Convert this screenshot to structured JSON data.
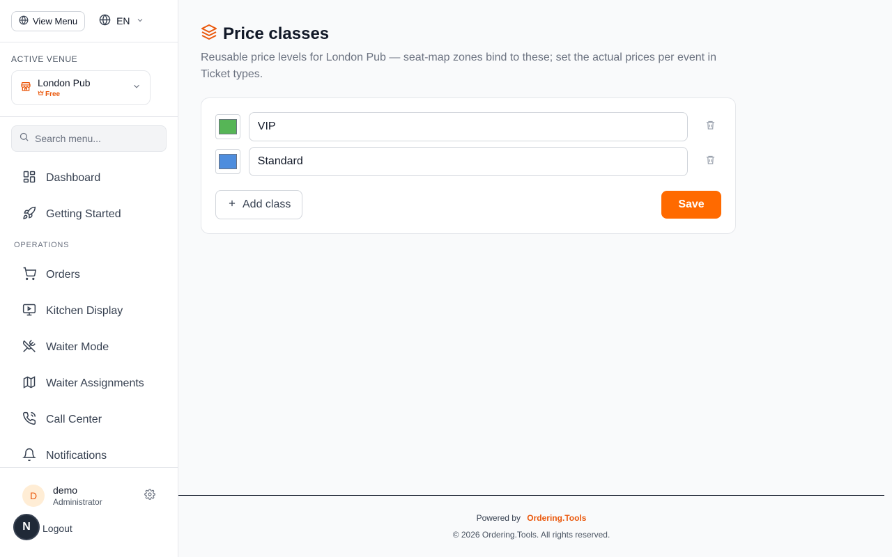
{
  "sidebar": {
    "view_menu_label": "View Menu",
    "language": "EN",
    "active_venue_label": "ACTIVE VENUE",
    "venue": {
      "name": "London Pub",
      "plan": "Free"
    },
    "search_placeholder": "Search menu...",
    "nav_top": [
      {
        "label": "Dashboard",
        "icon": "dashboard-icon"
      },
      {
        "label": "Getting Started",
        "icon": "rocket-icon"
      }
    ],
    "section_operations": "OPERATIONS",
    "nav_operations": [
      {
        "label": "Orders",
        "icon": "cart-icon"
      },
      {
        "label": "Kitchen Display",
        "icon": "monitor-play-icon"
      },
      {
        "label": "Waiter Mode",
        "icon": "utensils-crossed-icon"
      },
      {
        "label": "Waiter Assignments",
        "icon": "map-icon"
      },
      {
        "label": "Call Center",
        "icon": "phone-icon"
      },
      {
        "label": "Notifications",
        "icon": "bell-icon"
      }
    ],
    "user": {
      "initial": "D",
      "name": "demo",
      "role": "Administrator"
    },
    "logout_label": "Logout",
    "badge_letter": "N"
  },
  "main": {
    "title": "Price classes",
    "subtitle": "Reusable price levels for London Pub — seat-map zones bind to these; set the actual prices per event in Ticket types.",
    "classes": [
      {
        "name": "VIP",
        "color": "#56b556"
      },
      {
        "name": "Standard",
        "color": "#4e8ddd"
      }
    ],
    "add_label": "Add class",
    "save_label": "Save"
  },
  "footer": {
    "powered_by": "Powered by",
    "brand": "Ordering.Tools",
    "copyright": "© 2026 Ordering.Tools. All rights reserved."
  },
  "colors": {
    "accent": "#ff6a00",
    "brand_text": "#ea580c"
  }
}
